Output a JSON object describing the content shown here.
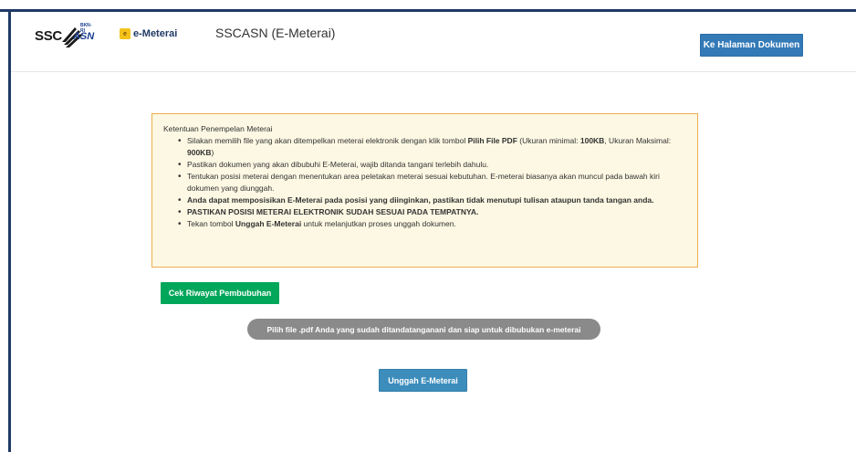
{
  "header": {
    "ssc_text": "SSC",
    "asn_text": "ASN",
    "bkn_text": "BKN-RI",
    "emeterai_text": "e-Meterai",
    "app_title": "SSCASN (E-Meterai)",
    "doc_button_label": "Ke Halaman Dokumen"
  },
  "notice": {
    "title": "Ketentuan Penempelan Meterai",
    "items": [
      {
        "pre": "Silakan memilih file yang akan ditempelkan meterai elektronik dengan klik tombol ",
        "bold": "Pilih File PDF",
        "post": " (Ukuran minimal: ",
        "bold2": "100KB",
        "post2": ", Ukuran Maksimal: ",
        "bold3": "900KB",
        "post3": ")"
      },
      {
        "text": "Pastikan dokumen yang akan dibubuhi E-Meterai, wajib ditanda tangani terlebih dahulu."
      },
      {
        "text": "Tentukan posisi meterai dengan menentukan area peletakan meterai sesuai kebutuhan. E-meterai biasanya akan muncul pada bawah kiri dokumen yang diunggah."
      },
      {
        "bold_text": "Anda dapat memposisikan E-Meterai pada posisi yang diinginkan, pastikan tidak menutupi tulisan ataupun tanda tangan anda."
      },
      {
        "bold_text": "PASTIKAN POSISI METERAI ELEKTRONIK SUDAH SESUAI PADA TEMPATNYA."
      },
      {
        "pre": "Tekan tombol ",
        "bold": "Unggah E-Meterai",
        "post": " untuk melanjutkan proses unggah dokumen."
      }
    ]
  },
  "actions": {
    "riwayat_label": "Cek Riwayat Pembubuhan",
    "file_pill_label": "Pilih file .pdf Anda yang sudah ditandatanganani dan siap untuk dibubukan e-meterai",
    "upload_label": "Unggah E-Meterai"
  },
  "colors": {
    "frame": "#1f3a66",
    "primary": "#337ab7",
    "success": "#00a65a",
    "warning_bg": "#fcf8e3",
    "warning_border": "#f0ad4e",
    "pill": "#8a8a8a"
  }
}
